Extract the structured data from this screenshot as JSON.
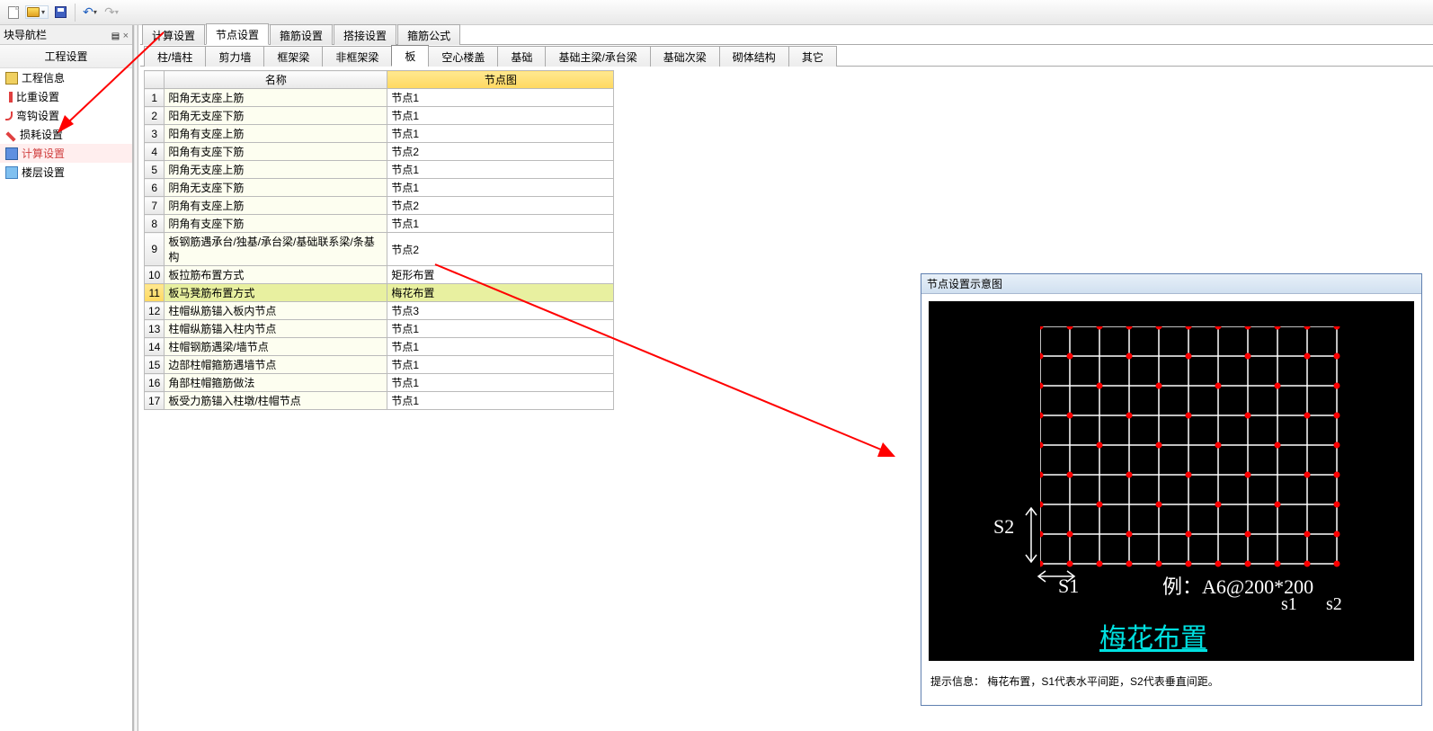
{
  "toolbar": {
    "items": [
      "new",
      "open",
      "save",
      "sep",
      "undo",
      "redo"
    ]
  },
  "sidebar": {
    "title": "块导航栏",
    "pin": "📌",
    "close": "×",
    "section": "工程设置",
    "items": [
      {
        "label": "工程信息",
        "icon": "ti-proj"
      },
      {
        "label": "比重设置",
        "icon": "ti-weight"
      },
      {
        "label": "弯钩设置",
        "icon": "ti-hook"
      },
      {
        "label": "损耗设置",
        "icon": "ti-loss"
      },
      {
        "label": "计算设置",
        "icon": "ti-calc",
        "highlight": true
      },
      {
        "label": "楼层设置",
        "icon": "ti-floor"
      }
    ]
  },
  "tabs1": {
    "items": [
      "计算设置",
      "节点设置",
      "箍筋设置",
      "搭接设置",
      "箍筋公式"
    ],
    "active": 1
  },
  "tabs2": {
    "items": [
      "柱/墙柱",
      "剪力墙",
      "框架梁",
      "非框架梁",
      "板",
      "空心楼盖",
      "基础",
      "基础主梁/承台梁",
      "基础次梁",
      "砌体结构",
      "其它"
    ],
    "active": 4
  },
  "table": {
    "headers": [
      "",
      "名称",
      "节点图"
    ],
    "rows": [
      {
        "n": 1,
        "name": "阳角无支座上筋",
        "node": "节点1"
      },
      {
        "n": 2,
        "name": "阳角无支座下筋",
        "node": "节点1"
      },
      {
        "n": 3,
        "name": "阳角有支座上筋",
        "node": "节点1"
      },
      {
        "n": 4,
        "name": "阳角有支座下筋",
        "node": "节点2"
      },
      {
        "n": 5,
        "name": "阴角无支座上筋",
        "node": "节点1"
      },
      {
        "n": 6,
        "name": "阴角无支座下筋",
        "node": "节点1"
      },
      {
        "n": 7,
        "name": "阴角有支座上筋",
        "node": "节点2"
      },
      {
        "n": 8,
        "name": "阴角有支座下筋",
        "node": "节点1"
      },
      {
        "n": 9,
        "name": "板钢筋遇承台/独基/承台梁/基础联系梁/条基构",
        "node": "节点2"
      },
      {
        "n": 10,
        "name": "板拉筋布置方式",
        "node": "矩形布置"
      },
      {
        "n": 11,
        "name": "板马凳筋布置方式",
        "node": "梅花布置",
        "selected": true
      },
      {
        "n": 12,
        "name": "柱帽纵筋锚入板内节点",
        "node": "节点3"
      },
      {
        "n": 13,
        "name": "柱帽纵筋锚入柱内节点",
        "node": "节点1"
      },
      {
        "n": 14,
        "name": "柱帽钢筋遇梁/墙节点",
        "node": "节点1"
      },
      {
        "n": 15,
        "name": "边部柱帽箍筋遇墙节点",
        "node": "节点1"
      },
      {
        "n": 16,
        "name": "角部柱帽箍筋做法",
        "node": "节点1"
      },
      {
        "n": 17,
        "name": "板受力筋锚入柱墩/柱帽节点",
        "node": "节点1"
      }
    ]
  },
  "preview": {
    "title": "节点设置示意图",
    "s1": "S1",
    "s2": "S2",
    "example": "例：A6@200*200",
    "s1low": "s1",
    "s2low": "s2",
    "pattern_name": "梅花布置",
    "hint_label": "提示信息：",
    "hint_text": "梅花布置，S1代表水平间距，S2代表垂直间距。"
  }
}
